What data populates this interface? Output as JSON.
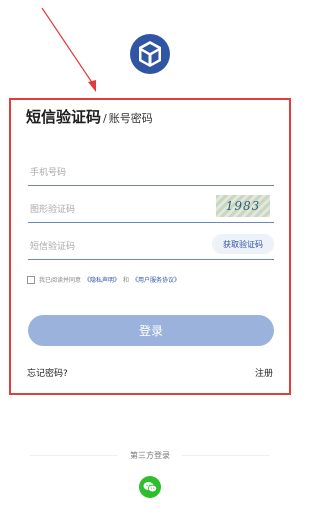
{
  "colors": {
    "brand": "#2f55a3",
    "annotation": "#e23d3d",
    "login_button": "#9bb2dc",
    "wechat": "#2dbe2d"
  },
  "header": {
    "logo_icon": "cube-logo-icon"
  },
  "tabs": {
    "active": "短信验证码",
    "separator": "/",
    "inactive": "账号密码"
  },
  "form": {
    "phone_placeholder": "手机号码",
    "captcha_placeholder": "图形验证码",
    "captcha_text": "1983",
    "sms_placeholder": "短信验证码",
    "sms_button": "获取验证码"
  },
  "agreement": {
    "prefix": "我已阅读并同意",
    "privacy": "《隐私声明》",
    "and": "和",
    "service": "《用户服务协议》"
  },
  "login_button": "登录",
  "links": {
    "forgot": "忘记密码?",
    "register": "注册"
  },
  "third_party": {
    "label": "第三方登录",
    "wechat_icon": "wechat-icon"
  }
}
